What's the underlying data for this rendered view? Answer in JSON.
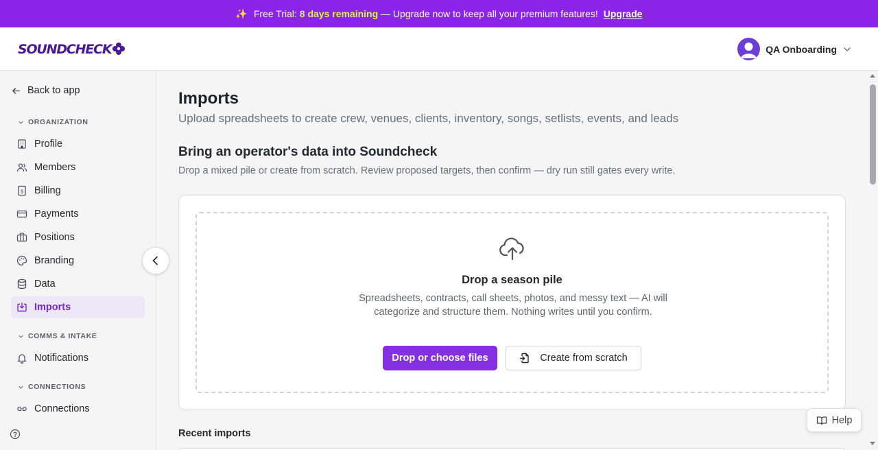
{
  "banner": {
    "icon": "sparkles-icon",
    "prefix": "Free Trial:",
    "highlight": "8 days remaining",
    "message": "— Upgrade now to keep all your premium features!",
    "link": "Upgrade",
    "background": "#8a24e8",
    "highlight_color": "#d6f15a"
  },
  "header": {
    "logo_text": "SOUNDCHECK",
    "user_name": "QA Onboarding"
  },
  "sidebar": {
    "back_label": "Back to app",
    "sections": [
      {
        "label": "ORGANIZATION"
      },
      {
        "label": "COMMS & INTAKE"
      },
      {
        "label": "CONNECTIONS"
      }
    ],
    "items": [
      {
        "label": "Profile",
        "icon": "building-icon"
      },
      {
        "label": "Members",
        "icon": "users-icon"
      },
      {
        "label": "Billing",
        "icon": "billing-icon"
      },
      {
        "label": "Payments",
        "icon": "credit-card-icon"
      },
      {
        "label": "Positions",
        "icon": "briefcase-icon"
      },
      {
        "label": "Branding",
        "icon": "palette-icon"
      },
      {
        "label": "Data",
        "icon": "database-icon"
      },
      {
        "label": "Imports",
        "icon": "import-icon",
        "active": true
      },
      {
        "label": "Notifications",
        "icon": "bell-icon"
      },
      {
        "label": "Connections",
        "icon": "link-icon"
      }
    ],
    "accent": "#7428d6"
  },
  "main": {
    "title": "Imports",
    "subtitle": "Upload spreadsheets to create crew, venues, clients, inventory, songs, setlists, events, and leads",
    "section_title": "Bring an operator's data into Soundcheck",
    "section_desc": "Drop a mixed pile or create from scratch. Review proposed targets, then confirm — dry run still gates every write.",
    "dropzone": {
      "title": "Drop a season pile",
      "text": "Spreadsheets, contracts, call sheets, photos, and messy text — AI will categorize and structure them. Nothing writes until you confirm.",
      "primary_button": "Drop or choose files",
      "secondary_button": "Create from scratch"
    },
    "recent_title": "Recent imports"
  },
  "help_button": "Help"
}
